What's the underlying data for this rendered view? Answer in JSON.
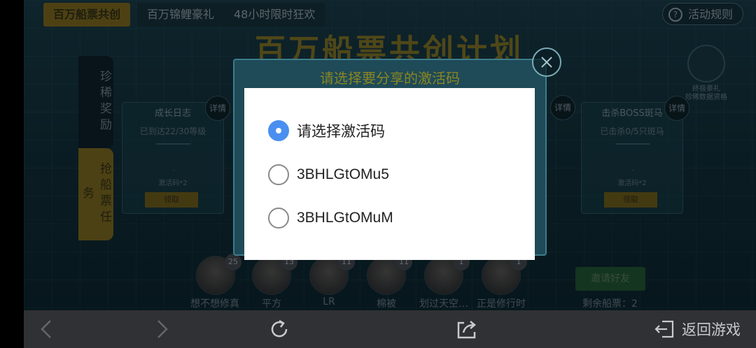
{
  "tabs": [
    "百万船票共创",
    "百万锦鲤豪礼",
    "48小时限时狂欢"
  ],
  "rules_label": "活动规则",
  "rules_icon": "?",
  "banner_title": "百万船票共创计划",
  "side_tabs": [
    "珍稀奖励",
    "抢船票任务"
  ],
  "cards": [
    {
      "title": "成长日志",
      "status": "已到达22/30等级",
      "reward": "激活码*2",
      "button": "领取",
      "detail": "详情"
    },
    {
      "title": "击杀BOSS斑马",
      "status": "已击杀0/5只斑马",
      "reward": "激活码*2",
      "button": "领取",
      "detail": "详情"
    }
  ],
  "middle_detail": "详情",
  "gift": {
    "line1": "终极豪礼",
    "line2": "珍稀数据资格"
  },
  "friends": [
    {
      "name": "想不想修真",
      "level": "25"
    },
    {
      "name": "平方",
      "level": "13"
    },
    {
      "name": "LR",
      "level": "11"
    },
    {
      "name": "棉被",
      "level": "11"
    },
    {
      "name": "划过天空…",
      "level": "1"
    },
    {
      "name": "正是修行时",
      "level": "1"
    }
  ],
  "invite_label": "邀请好友",
  "tickets_label": "剩余船票：2",
  "share_panel_title": "请选择要分享的激活码",
  "dialog": {
    "selected_index": 0,
    "options": [
      "请选择激活码",
      "3BHLGtOMu5",
      "3BHLGtOMuM"
    ]
  },
  "bottom_nav": {
    "back_label": "返回游戏",
    "icons": [
      "back-arrow-icon",
      "forward-arrow-icon",
      "refresh-icon",
      "share-icon",
      "exit-icon"
    ]
  },
  "colors": {
    "radio_selected": "#4a8ff0",
    "bottom_bar": "#2f3134"
  }
}
